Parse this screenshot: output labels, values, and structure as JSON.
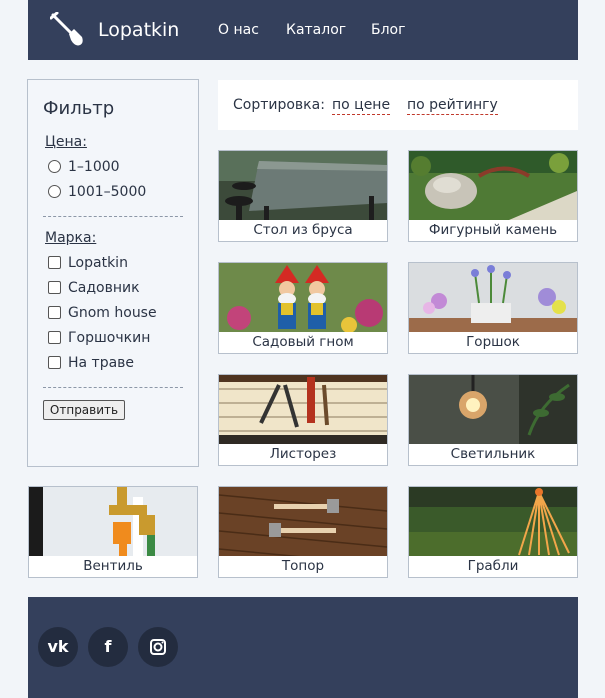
{
  "header": {
    "brand": "Lopatkin",
    "nav": [
      {
        "label": "О нас"
      },
      {
        "label": "Каталог"
      },
      {
        "label": "Блог"
      }
    ]
  },
  "filter": {
    "title": "Фильтр",
    "price": {
      "title": "Цена:",
      "options": [
        "1–1000",
        "1001–5000"
      ]
    },
    "brand": {
      "title": "Марка:",
      "options": [
        "Lopatkin",
        "Садовник",
        "Gnom house",
        "Горшочкин",
        "На траве"
      ]
    },
    "submit_label": "Отправить"
  },
  "sort": {
    "label": "Сортировка:",
    "by_price": "по цене",
    "by_rating": "по рейтингу"
  },
  "products": [
    {
      "name": "Стол из бруса"
    },
    {
      "name": "Фигурный камень"
    },
    {
      "name": "Садовый гном"
    },
    {
      "name": "Горшок"
    },
    {
      "name": "Листорез"
    },
    {
      "name": "Светильник"
    },
    {
      "name": "Вентиль"
    },
    {
      "name": "Топор"
    },
    {
      "name": "Грабли"
    }
  ],
  "footer": {
    "social": [
      {
        "icon": "vk-icon",
        "glyph": "vk"
      },
      {
        "icon": "facebook-icon",
        "glyph": "f"
      },
      {
        "icon": "instagram-icon",
        "glyph": ""
      }
    ]
  },
  "colors": {
    "header_bg": "#34405c",
    "page_bg": "#f2f5f9",
    "social_bg": "#232c3f",
    "accent_underline": "#c0392b"
  }
}
